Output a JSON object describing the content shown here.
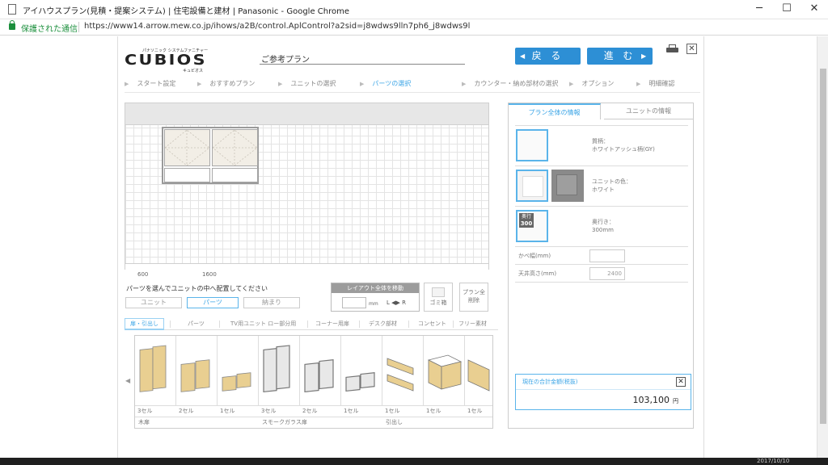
{
  "browser": {
    "tab_title": "アイハウスプラン(見積・提案システム) | 住宅設備と建材 | Panasonic - Google Chrome",
    "secure_label": "保護された通信",
    "url": "https://www14.arrow.mew.co.jp/ihows/a2B/control.AplControl?a2sid=j8wdws9lln7ph6_j8wdws9l",
    "min": "─",
    "max": "☐",
    "close": "✕"
  },
  "header": {
    "logo_sub": "パナソニック システムファニチャー",
    "logo_main": "CUBIOS",
    "logo_kana": "キュビオス",
    "plan_name": "ご参考プラン",
    "back_label": "戻 る",
    "next_label": "進 む",
    "back_arrow": "◀",
    "next_arrow": "▶"
  },
  "steps": [
    "スタート設定",
    "おすすめプラン",
    "ユニットの選択",
    "パーツの選択",
    "カウンター・納め部材の選択",
    "オプション",
    "明細確認"
  ],
  "active_step": "パーツの選択",
  "step_chevron": "▶",
  "canvas": {
    "ruler": [
      "600",
      "1600"
    ]
  },
  "controls": {
    "hint": "パーツを選んでユニットの中へ配置してください",
    "toggle_unit": "ユニット",
    "toggle_parts": "パーツ",
    "toggle_finish": "納まり",
    "layout_title": "レイアウト全体を移動",
    "layout_unit": "mm",
    "layout_lr": "L ◀▶ R",
    "trash_label": "ゴミ箱",
    "clear_label": "プラン全削除"
  },
  "parts_tabs": [
    "扉・引出し",
    "パーツ",
    "TV用ユニット ロー部分用",
    "コーナー用扉",
    "デスク部材",
    "コンセント",
    "フリー素材"
  ],
  "parts": [
    {
      "cells": "3セル"
    },
    {
      "cells": "2セル"
    },
    {
      "cells": "1セル"
    },
    {
      "cells": "3セル"
    },
    {
      "cells": "2セル"
    },
    {
      "cells": "1セル"
    },
    {
      "cells": "1セル"
    },
    {
      "cells": "1セル"
    },
    {
      "cells": "1セル"
    }
  ],
  "part_groups": [
    "木扉",
    "スモークガラス扉",
    "引出し"
  ],
  "parts_nav_left": "◀",
  "info_panel": {
    "tab_plan": "プラン全体の情報",
    "tab_unit": "ユニットの情報",
    "material_label": "質柄：",
    "material_value": "ホワイトアッシュ柄(GY)",
    "unit_color_label": "ユニットの色：",
    "unit_color_value": "ホワイト",
    "depth_badge_top": "奥行",
    "depth_badge_num": "300",
    "depth_label": "奥行き：",
    "depth_value": "300mm",
    "wall_width_label": "かべ幅(mm)",
    "wall_width_value": "",
    "ceiling_label": "天井高さ(mm)",
    "ceiling_value": "2400"
  },
  "total": {
    "label": "現在の合計金額(税抜)",
    "value": "103,100",
    "currency": "円",
    "close": "✕"
  },
  "taskbar": {
    "clock": "2017/10/10"
  },
  "colors": {
    "accent": "#3aa4e6",
    "nav_button": "#2d8fd5",
    "secure": "#1b8f3c"
  }
}
